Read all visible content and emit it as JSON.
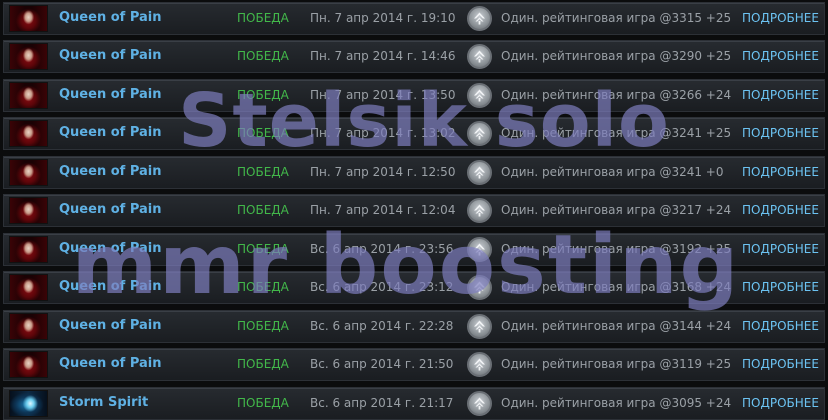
{
  "matches": [
    {
      "portrait": "qop",
      "hero": "Queen of Pain",
      "result": "ПОБЕДА",
      "date": "Пн. 7 апр 2014 г. 19:10",
      "game": "Один. рейтинговая игра @3315 +25",
      "details": "ПОДРОБНЕЕ"
    },
    {
      "portrait": "qop",
      "hero": "Queen of Pain",
      "result": "ПОБЕДА",
      "date": "Пн. 7 апр 2014 г. 14:46",
      "game": "Один. рейтинговая игра @3290 +25",
      "details": "ПОДРОБНЕЕ"
    },
    {
      "portrait": "qop",
      "hero": "Queen of Pain",
      "result": "ПОБЕДА",
      "date": "Пн. 7 апр 2014 г. 13:50",
      "game": "Один. рейтинговая игра @3266 +24",
      "details": "ПОДРОБНЕЕ"
    },
    {
      "portrait": "qop",
      "hero": "Queen of Pain",
      "result": "ПОБЕДА",
      "date": "Пн. 7 апр 2014 г. 13:02",
      "game": "Один. рейтинговая игра @3241 +25",
      "details": "ПОДРОБНЕЕ"
    },
    {
      "portrait": "qop",
      "hero": "Queen of Pain",
      "result": "ПОБЕДА",
      "date": "Пн. 7 апр 2014 г. 12:50",
      "game": "Один. рейтинговая игра @3241 +0",
      "details": "ПОДРОБНЕЕ"
    },
    {
      "portrait": "qop",
      "hero": "Queen of Pain",
      "result": "ПОБЕДА",
      "date": "Пн. 7 апр 2014 г. 12:04",
      "game": "Один. рейтинговая игра @3217 +24",
      "details": "ПОДРОБНЕЕ"
    },
    {
      "portrait": "qop",
      "hero": "Queen of Pain",
      "result": "ПОБЕДА",
      "date": "Вс. 6 апр 2014 г. 23:56",
      "game": "Один. рейтинговая игра @3192 +25",
      "details": "ПОДРОБНЕЕ"
    },
    {
      "portrait": "qop",
      "hero": "Queen of Pain",
      "result": "ПОБЕДА",
      "date": "Вс. 6 апр 2014 г. 23:12",
      "game": "Один. рейтинговая игра @3168 +24",
      "details": "ПОДРОБНЕЕ"
    },
    {
      "portrait": "qop",
      "hero": "Queen of Pain",
      "result": "ПОБЕДА",
      "date": "Вс. 6 апр 2014 г. 22:28",
      "game": "Один. рейтинговая игра @3144 +24",
      "details": "ПОДРОБНЕЕ"
    },
    {
      "portrait": "qop",
      "hero": "Queen of Pain",
      "result": "ПОБЕДА",
      "date": "Вс. 6 апр 2014 г. 21:50",
      "game": "Один. рейтинговая игра @3119 +25",
      "details": "ПОДРОБНЕЕ"
    },
    {
      "portrait": "storm",
      "hero": "Storm Spirit",
      "result": "ПОБЕДА",
      "date": "Вс. 6 апр 2014 г. 21:17",
      "game": "Один. рейтинговая игра @3095 +24",
      "details": "ПОДРОБНЕЕ"
    }
  ],
  "watermark": {
    "line1": "Stelsik solo",
    "line2": "mmr boosting"
  },
  "icons": {
    "mode": "ranked-mode-icon"
  },
  "colors": {
    "hero": "#5fb1e4",
    "victory": "#42b84a",
    "text": "#9aa0a6",
    "link": "#6cc3f2"
  }
}
